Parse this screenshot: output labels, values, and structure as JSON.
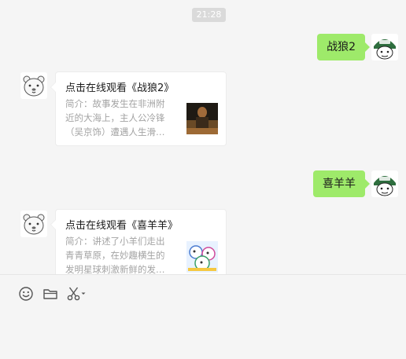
{
  "chat": {
    "timestamp": "21:28",
    "messages": [
      {
        "sender": "me",
        "text": "战狼2"
      },
      {
        "sender": "bot",
        "title": "点击在线观看《战狼2》",
        "desc": "简介：故事发生在非洲附近的大海上，主人公冷锋（吴京饰）遭遇人生滑…"
      },
      {
        "sender": "me",
        "text": "喜羊羊"
      },
      {
        "sender": "bot",
        "title": "点击在线观看《喜羊羊》",
        "desc": "简介：讲述了小羊们走出青青草原，在妙趣横生的发明星球刺激新鲜的发…"
      }
    ]
  },
  "toolbar": {
    "icons": [
      "emoji-icon",
      "folder-icon",
      "scissors-icon",
      "chevron-down-icon"
    ]
  },
  "colors": {
    "my_bubble": "#9eea6a",
    "background": "#f5f5f5",
    "timestamp_bg": "#dadada"
  }
}
